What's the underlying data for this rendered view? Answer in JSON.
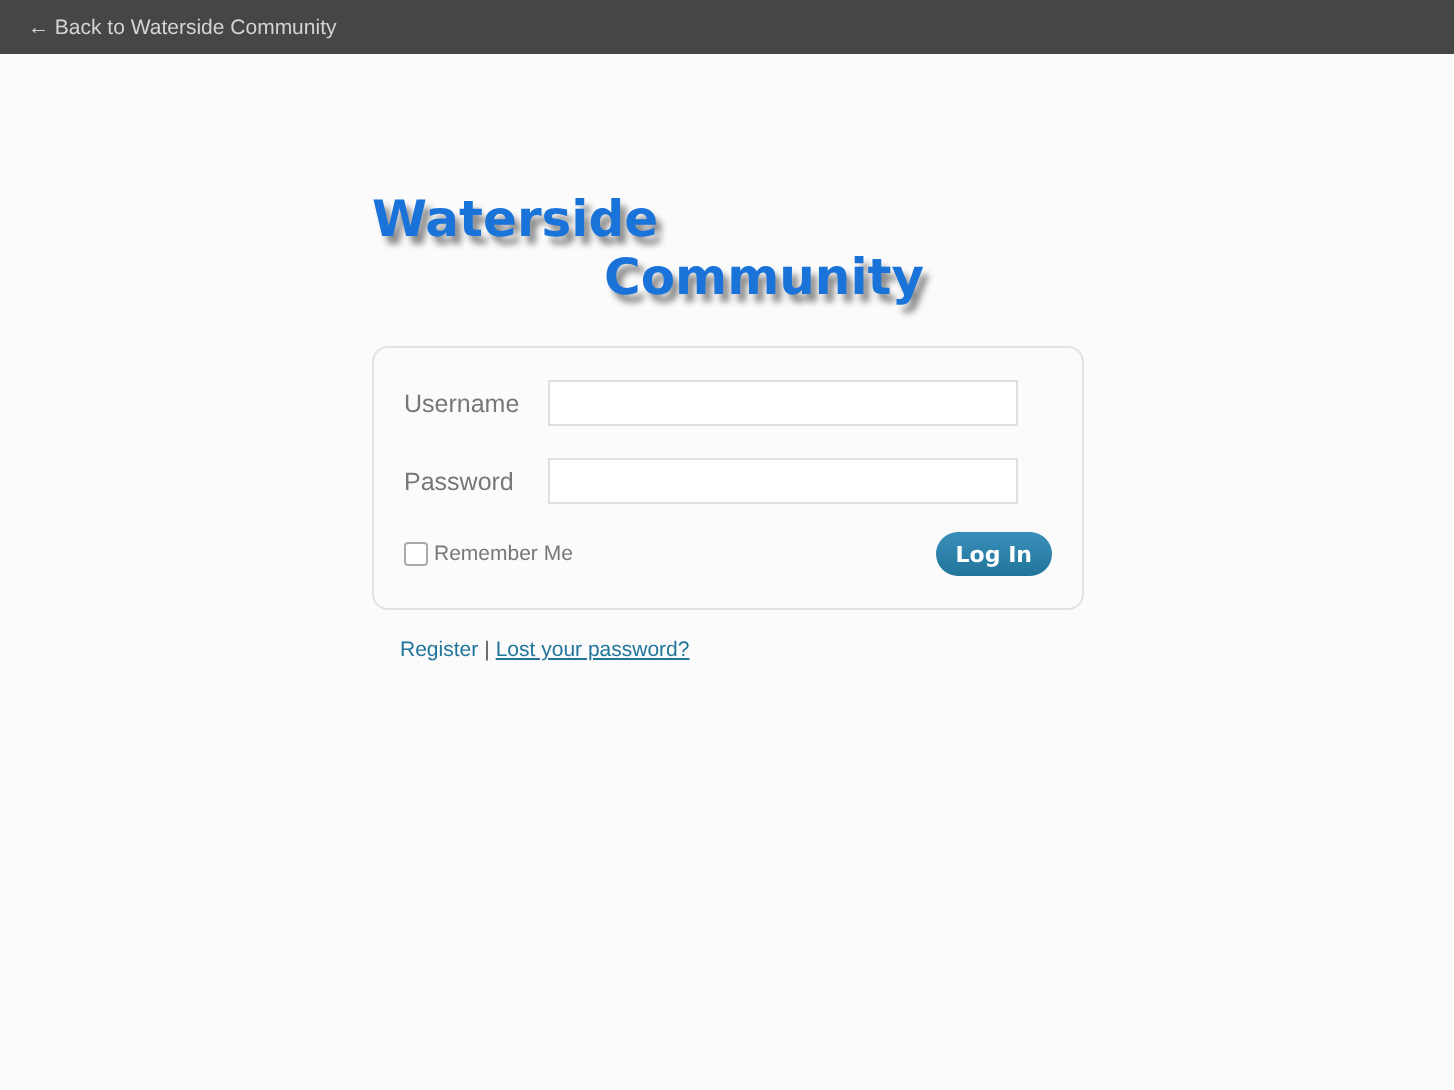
{
  "top_bar": {
    "back_link": "← Back to Waterside Community"
  },
  "logo": {
    "lines": [
      "Waterside",
      "Community"
    ]
  },
  "form": {
    "fields": [
      {
        "label": "Username"
      },
      {
        "label": "Password"
      }
    ],
    "remember": {
      "label": "Remember Me",
      "checked": false
    },
    "submit": "Log In"
  },
  "links": {
    "register": "Register",
    "separator": "|",
    "lost_password": "Lost your password?"
  }
}
